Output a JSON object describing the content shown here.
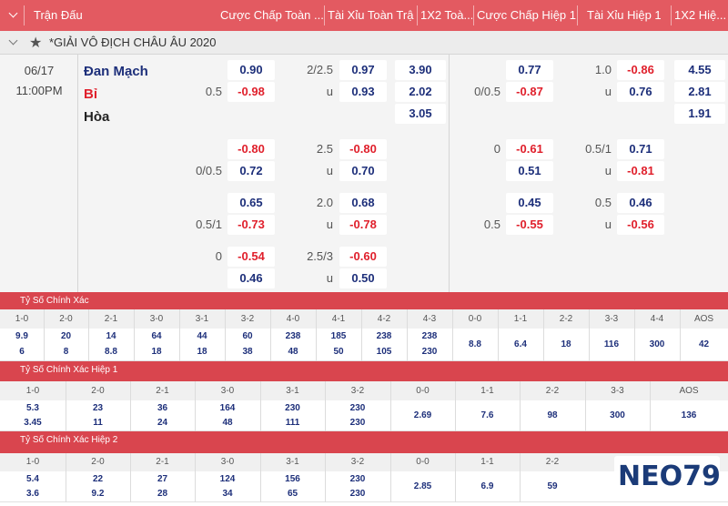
{
  "header": {
    "match": "Trận Đấu",
    "ah_ft": "Cược Chấp Toàn ...",
    "ou_ft": "Tài Xỉu Toàn Trận",
    "x12_ft": "1X2 Toà...",
    "ah_h1": "Cược Chấp Hiệp 1",
    "ou_h1": "Tài Xỉu Hiệp 1",
    "x12_h1": "1X2 Hiệ..."
  },
  "league": {
    "name": "*GIẢI VÔ ĐỊCH CHÂU ÂU 2020"
  },
  "match": {
    "date": "06/17",
    "time": "11:00PM",
    "home": "Đan Mạch",
    "away": "Bỉ",
    "draw": "Hòa"
  },
  "odds": {
    "ft_ah_line1": "0.5",
    "ft_ah_home1": "0.90",
    "ft_ah_away1": "-0.98",
    "ft_ou_line1": "2/2.5",
    "ft_ou_u1": "u",
    "ft_ou_o1": "0.97",
    "ft_ou_un1": "0.93",
    "ft_1": "3.90",
    "ft_2": "2.02",
    "ft_x": "3.05",
    "h1_ah_line1": "0/0.5",
    "h1_ah_home1": "0.77",
    "h1_ah_away1": "-0.87",
    "h1_ou_line1": "1.0",
    "h1_ou_u1": "u",
    "h1_ou_o1": "-0.86",
    "h1_ou_un1": "0.76",
    "h1_1": "4.55",
    "h1_2": "2.81",
    "h1_x": "1.91",
    "ft_ah_line2": "0/0.5",
    "ft_ah_home2": "-0.80",
    "ft_ah_away2": "0.72",
    "ft_ou_line2": "2.5",
    "ft_ou_u2": "u",
    "ft_ou_o2": "-0.80",
    "ft_ou_un2": "0.70",
    "h1_ah_line2": "0",
    "h1_ah_home2": "-0.61",
    "h1_ah_away2": "0.51",
    "h1_ou_line2": "0.5/1",
    "h1_ou_u2": "u",
    "h1_ou_o2": "0.71",
    "h1_ou_un2": "-0.81",
    "ft_ah_line3": "0.5/1",
    "ft_ah_home3": "0.65",
    "ft_ah_away3": "-0.73",
    "ft_ou_line3": "2.0",
    "ft_ou_u3": "u",
    "ft_ou_o3": "0.68",
    "ft_ou_un3": "-0.78",
    "h1_ah_line3": "0.5",
    "h1_ah_home3": "0.45",
    "h1_ah_away3": "-0.55",
    "h1_ou_line3": "0.5",
    "h1_ou_u3": "u",
    "h1_ou_o3": "0.46",
    "h1_ou_un3": "-0.56",
    "ft_ah_line4": "0",
    "ft_ah_home4": "-0.54",
    "ft_ah_away4": "0.46",
    "ft_ou_line4": "2.5/3",
    "ft_ou_u4": "u",
    "ft_ou_o4": "-0.60",
    "ft_ou_un4": "0.50"
  },
  "cs_full": {
    "title": "Tỷ Số Chính Xác",
    "h": [
      "1-0",
      "2-0",
      "2-1",
      "3-0",
      "3-1",
      "3-2",
      "4-0",
      "4-1",
      "4-2",
      "4-3",
      "0-0",
      "1-1",
      "2-2",
      "3-3",
      "4-4",
      "AOS"
    ],
    "a": [
      "9.9",
      "20",
      "14",
      "64",
      "44",
      "60",
      "238",
      "185",
      "238",
      "238",
      "8.8",
      "6.4",
      "18",
      "116",
      "300",
      "42"
    ],
    "b": [
      "6",
      "8",
      "8.8",
      "18",
      "18",
      "38",
      "48",
      "50",
      "105",
      "230",
      "",
      "",
      "",
      "",
      "",
      ""
    ]
  },
  "cs_h1": {
    "title": "Tỷ Số Chính Xác Hiệp 1",
    "h": [
      "1-0",
      "2-0",
      "2-1",
      "3-0",
      "3-1",
      "3-2",
      "0-0",
      "1-1",
      "2-2",
      "3-3",
      "AOS"
    ],
    "a": [
      "5.3",
      "23",
      "36",
      "164",
      "230",
      "230",
      "2.69",
      "7.6",
      "98",
      "300",
      "136"
    ],
    "b": [
      "3.45",
      "11",
      "24",
      "48",
      "111",
      "230",
      "",
      "",
      "",
      "",
      ""
    ]
  },
  "cs_h2": {
    "title": "Tỷ Số Chính Xác Hiệp 2",
    "h": [
      "1-0",
      "2-0",
      "2-1",
      "3-0",
      "3-1",
      "3-2",
      "0-0",
      "1-1",
      "2-2"
    ],
    "a": [
      "5.4",
      "22",
      "27",
      "124",
      "156",
      "230",
      "2.85",
      "6.9",
      "59"
    ],
    "b": [
      "3.6",
      "9.2",
      "28",
      "34",
      "65",
      "230",
      "",
      "",
      ""
    ]
  },
  "logo": {
    "text": "NEO79"
  },
  "colors": {
    "header": "#e35a61",
    "section": "#d9454e",
    "positive": "#1d2f7a",
    "negative": "#e0202c"
  }
}
